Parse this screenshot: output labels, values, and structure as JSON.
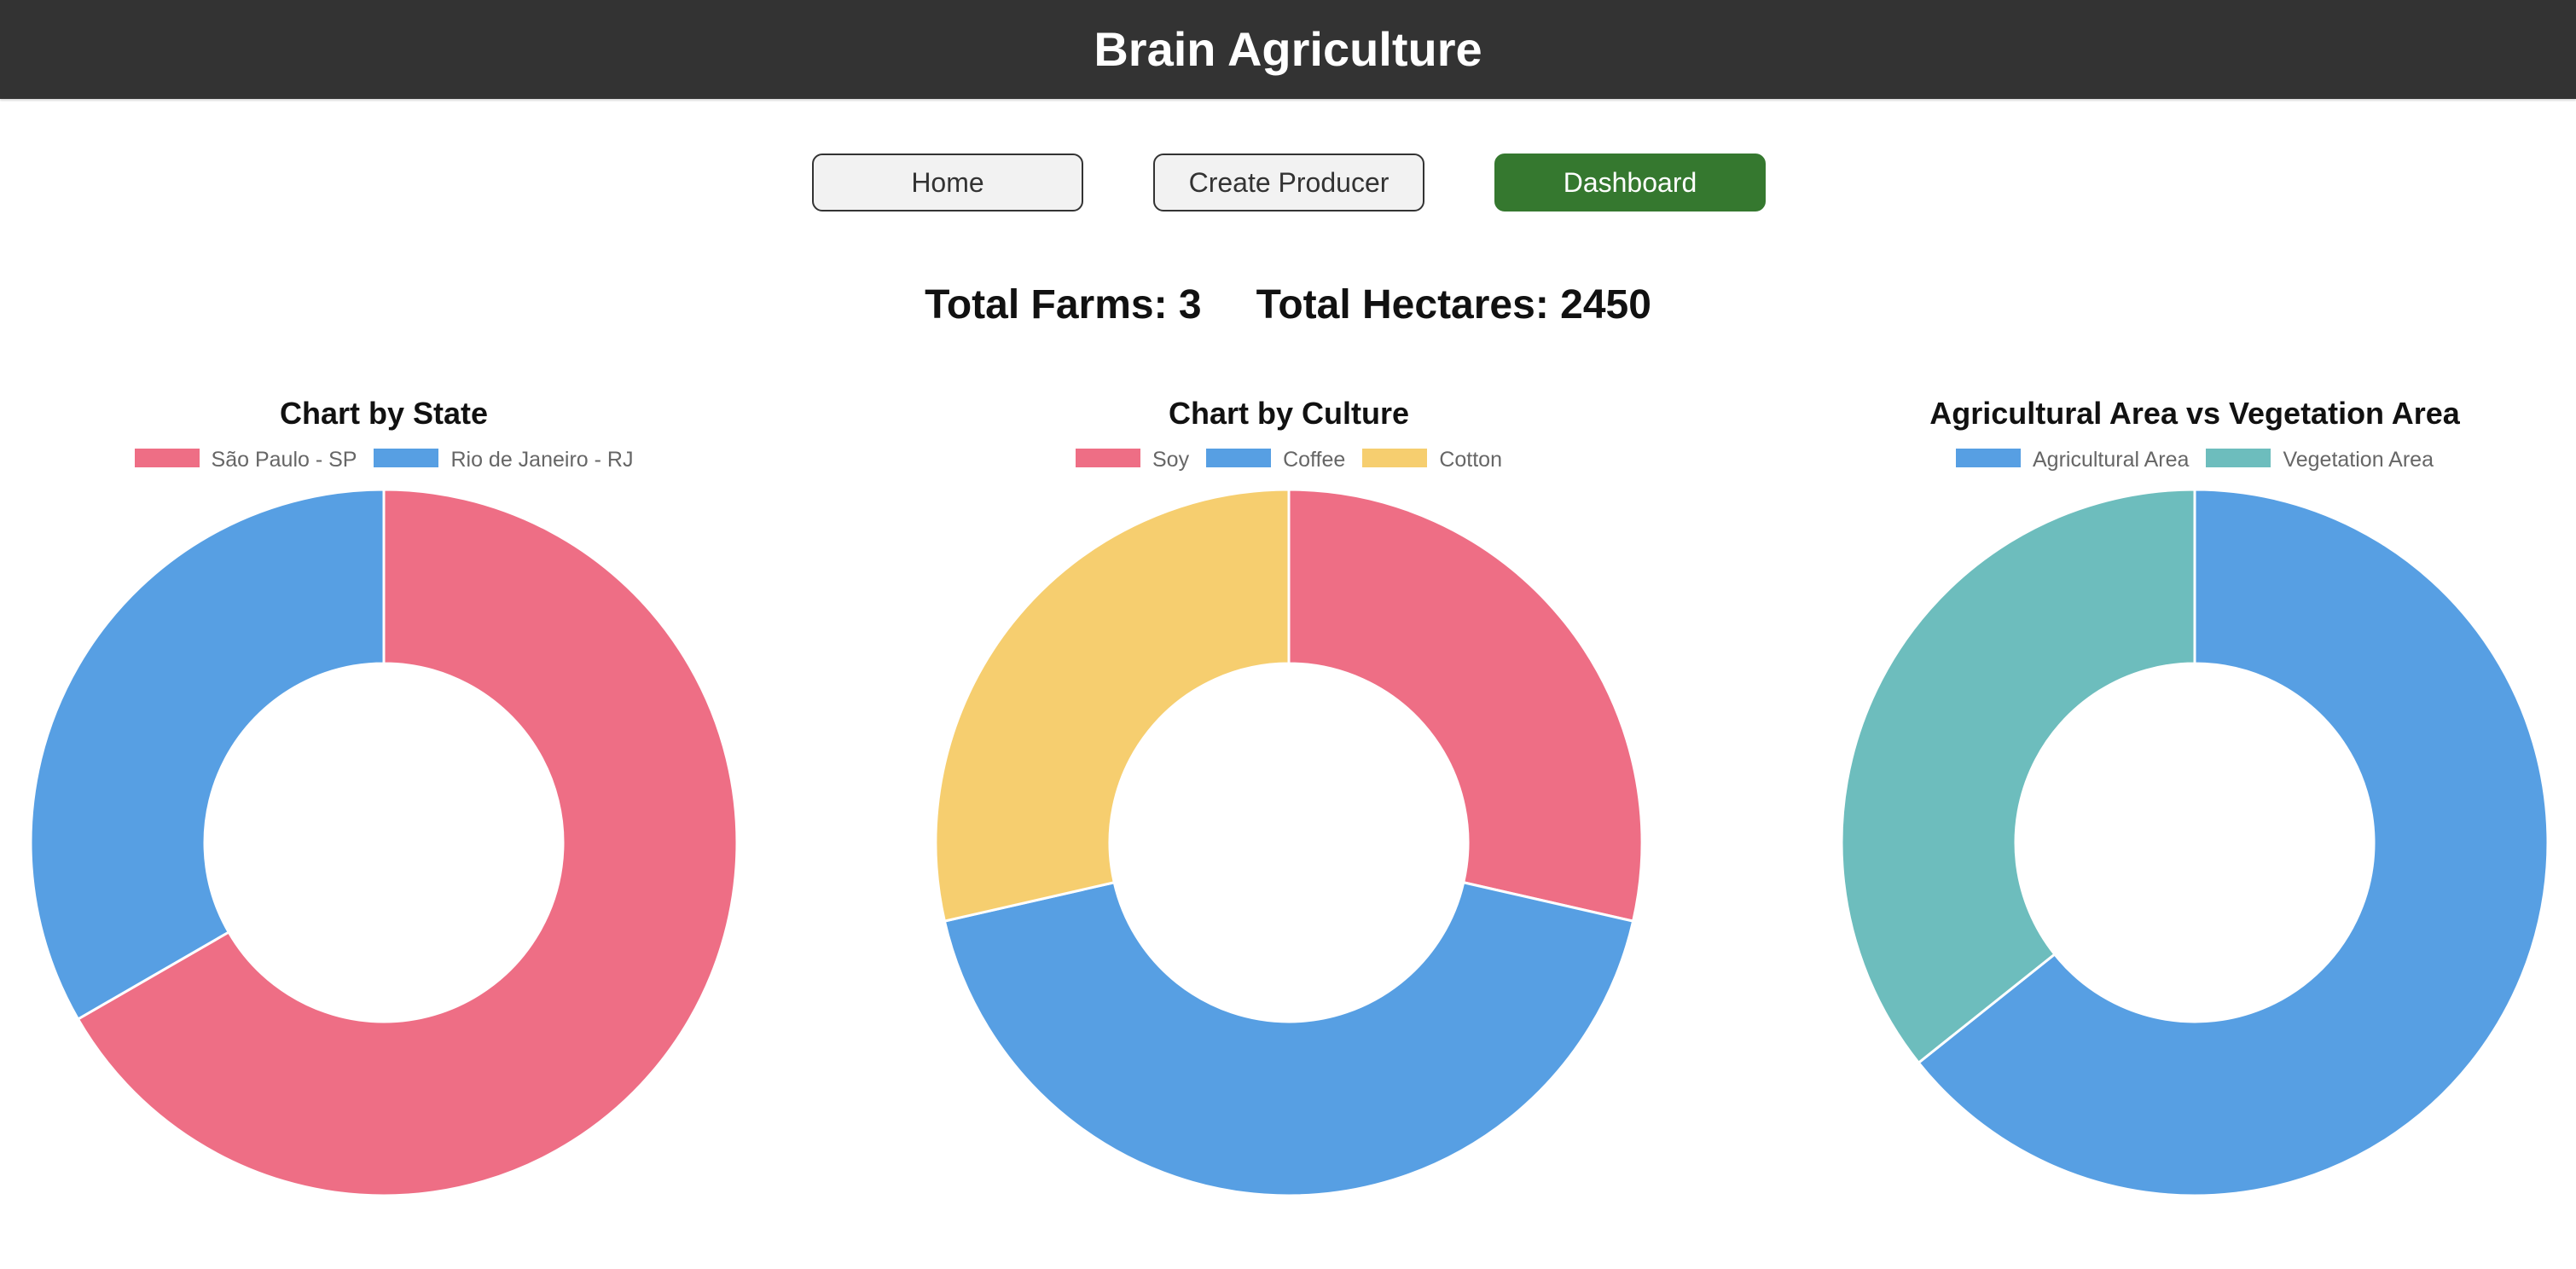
{
  "header": {
    "title": "Brain Agriculture"
  },
  "nav": {
    "home_label": "Home",
    "create_label": "Create Producer",
    "dashboard_label": "Dashboard"
  },
  "totals": {
    "farms_text": "Total Farms: 3",
    "hectares_text": "Total Hectares: 2450"
  },
  "colors": {
    "header_bg": "#333333",
    "active_button": "#35782f",
    "red": "#ee6e85",
    "blue": "#579fe3",
    "yellow": "#f6ce6f",
    "teal": "#6dbdbd"
  },
  "chart_data": [
    {
      "type": "pie",
      "variant": "doughnut",
      "title": "Chart by State",
      "categories": [
        "São Paulo - SP",
        "Rio de Janeiro - RJ"
      ],
      "values": [
        2,
        1
      ],
      "colors": [
        "#ee6e85",
        "#579fe3"
      ],
      "legend": "top"
    },
    {
      "type": "pie",
      "variant": "doughnut",
      "title": "Chart by Culture",
      "categories": [
        "Soy",
        "Coffee",
        "Cotton"
      ],
      "values": [
        1,
        1.5,
        1
      ],
      "colors": [
        "#ee6e85",
        "#579fe3",
        "#f6ce6f"
      ],
      "legend": "top"
    },
    {
      "type": "pie",
      "variant": "doughnut",
      "title": "Agricultural Area vs Vegetation Area",
      "categories": [
        "Agricultural Area",
        "Vegetation Area"
      ],
      "values": [
        1.8,
        1
      ],
      "colors": [
        "#579fe3",
        "#6dbdbd"
      ],
      "legend": "top"
    }
  ]
}
